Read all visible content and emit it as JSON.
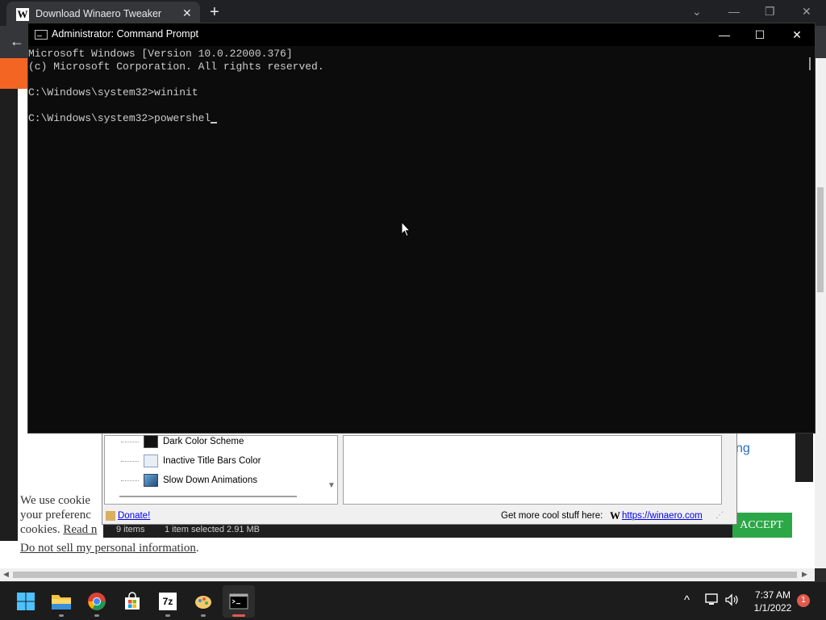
{
  "browser": {
    "tab_title": "Download Winaero Tweaker",
    "tab_favicon": "W",
    "tab_close": "✕",
    "new_tab": "+",
    "back": "←",
    "chevron": "⌄",
    "minimize": "—",
    "restore": "❐",
    "close": "✕"
  },
  "page": {
    "partial_heading": "ng",
    "cookie_line1": "We use cookie",
    "cookie_line2": "your preferenc",
    "cookie_line3_prefix": "cookies. ",
    "cookie_read_more": "Read n",
    "do_not_sell": "Do not sell my personal information",
    "do_not_sell_suffix": ".",
    "accept_label": "ACCEPT",
    "accept_color": "#2ca748"
  },
  "tweaker": {
    "tree_items": [
      {
        "label": "Dark Color Scheme",
        "icon": "dark-square-icon"
      },
      {
        "label": "Inactive Title Bars Color",
        "icon": "window-icon"
      },
      {
        "label": "Slow Down Animations",
        "icon": "monitor-icon"
      }
    ],
    "donate_label": "Donate!",
    "get_more_label": "Get more cool stuff here:",
    "winaero_logo": "W",
    "winaero_url": "https://winaero.com"
  },
  "explorer_status": {
    "items_count": "9 items",
    "selection": "1 item selected  2.91 MB"
  },
  "cmd": {
    "title": "Administrator: Command Prompt",
    "minimize": "—",
    "maximize": "☐",
    "close": "✕",
    "lines": [
      "Microsoft Windows [Version 10.0.22000.376]",
      "(c) Microsoft Corporation. All rights reserved.",
      "",
      "C:\\Windows\\system32>wininit",
      "",
      "C:\\Windows\\system32>powershel"
    ]
  },
  "taskbar": {
    "apps": [
      {
        "name": "start-button",
        "icon": "windows-logo-icon"
      },
      {
        "name": "file-explorer",
        "icon": "folder-icon"
      },
      {
        "name": "chrome",
        "icon": "chrome-icon"
      },
      {
        "name": "microsoft-store",
        "icon": "store-icon"
      },
      {
        "name": "7zip",
        "icon": "7zip-icon",
        "label": "7z"
      },
      {
        "name": "paint",
        "icon": "paint-icon"
      },
      {
        "name": "command-prompt",
        "icon": "cmd-icon"
      }
    ],
    "tray_chevron": "^",
    "time": "7:37 AM",
    "date": "1/1/2022",
    "notification_count": "1"
  }
}
